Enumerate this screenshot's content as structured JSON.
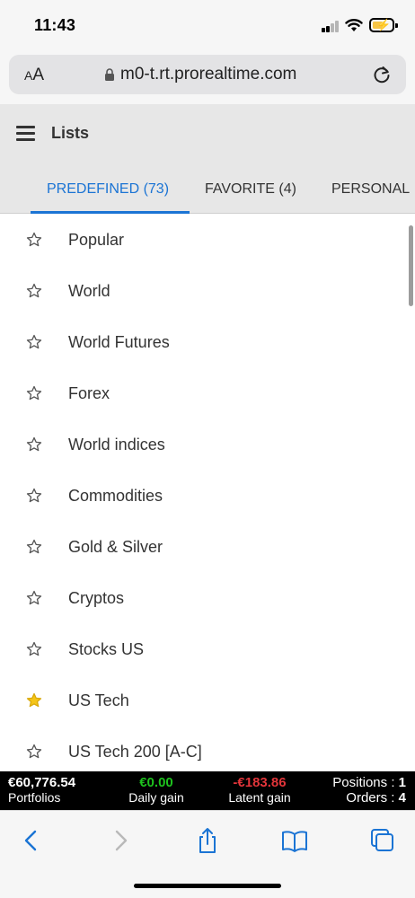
{
  "status_bar": {
    "time": "11:43"
  },
  "browser": {
    "text_size_label_small": "A",
    "text_size_label_large": "A",
    "url": "m0-t.rt.prorealtime.com"
  },
  "header": {
    "title": "Lists",
    "tabs": [
      {
        "label": "PREDEFINED (73)",
        "active": true
      },
      {
        "label": "FAVORITE (4)",
        "active": false
      },
      {
        "label": "PERSONAL",
        "active": false
      }
    ]
  },
  "lists": [
    {
      "label": "Popular",
      "favorite": false
    },
    {
      "label": "World",
      "favorite": false
    },
    {
      "label": "World Futures",
      "favorite": false
    },
    {
      "label": "Forex",
      "favorite": false
    },
    {
      "label": "World indices",
      "favorite": false
    },
    {
      "label": "Commodities",
      "favorite": false
    },
    {
      "label": "Gold & Silver",
      "favorite": false
    },
    {
      "label": "Cryptos",
      "favorite": false
    },
    {
      "label": "Stocks US",
      "favorite": false
    },
    {
      "label": "US Tech",
      "favorite": true
    },
    {
      "label": "US Tech 200 [A-C]",
      "favorite": false
    }
  ],
  "portfolio_bar": {
    "portfolios_value": "€60,776.54",
    "portfolios_label": "Portfolios",
    "daily_gain_value": "€0.00",
    "daily_gain_label": "Daily gain",
    "latent_gain_value": "-€183.86",
    "latent_gain_label": "Latent gain",
    "positions_label": "Positions : ",
    "positions_value": "1",
    "orders_label": "Orders : ",
    "orders_value": "4"
  },
  "colors": {
    "accent": "#1b74d4",
    "favorite_star": "#f5c518",
    "gain_positive": "#1ec21e",
    "gain_negative": "#e2353a"
  },
  "icons": [
    "lock-icon",
    "reload-icon",
    "menu-icon",
    "star-icon",
    "back-icon",
    "forward-icon",
    "share-icon",
    "bookmarks-icon",
    "tabs-icon"
  ]
}
